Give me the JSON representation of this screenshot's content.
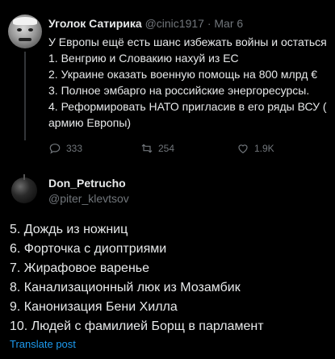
{
  "quoted_tweet": {
    "author_name": "Уголок Сатирика",
    "author_handle": "@cinic1917",
    "separator": "·",
    "date": "Mar 6",
    "lines": [
      "У Европы ещё есть шанс избежать войны и остаться",
      "1. Венгрию и Словакию нахуй из ЕС",
      "2. Украине оказать военную помощь на 800 млрд €",
      "3. Полное эмбарго на российские энергоресурсы.",
      "4. Реформировать НАТО пригласив в его ряды ВСУ (",
      "армию Европы)"
    ],
    "replies": "333",
    "retweets": "254",
    "likes": "1.9K"
  },
  "reply_tweet": {
    "author_name": "Don_Petrucho",
    "author_handle": "@piter_klevtsov",
    "lines": [
      "5. Дождь из ножниц",
      "6. Форточка с диоптриями",
      "7. Жирафовое варенье",
      "8. Канализационный люк из Мозамбик",
      "9. Канонизация Бени Хилла",
      "10. Людей с фамилией Борщ в парламент"
    ],
    "translate_label": "Translate post"
  },
  "icons": [
    "reply-icon",
    "retweet-icon",
    "like-icon"
  ],
  "colors": {
    "background": "#000000",
    "text": "#e7e9ea",
    "muted": "#71767b",
    "link": "#1d9bf0"
  }
}
